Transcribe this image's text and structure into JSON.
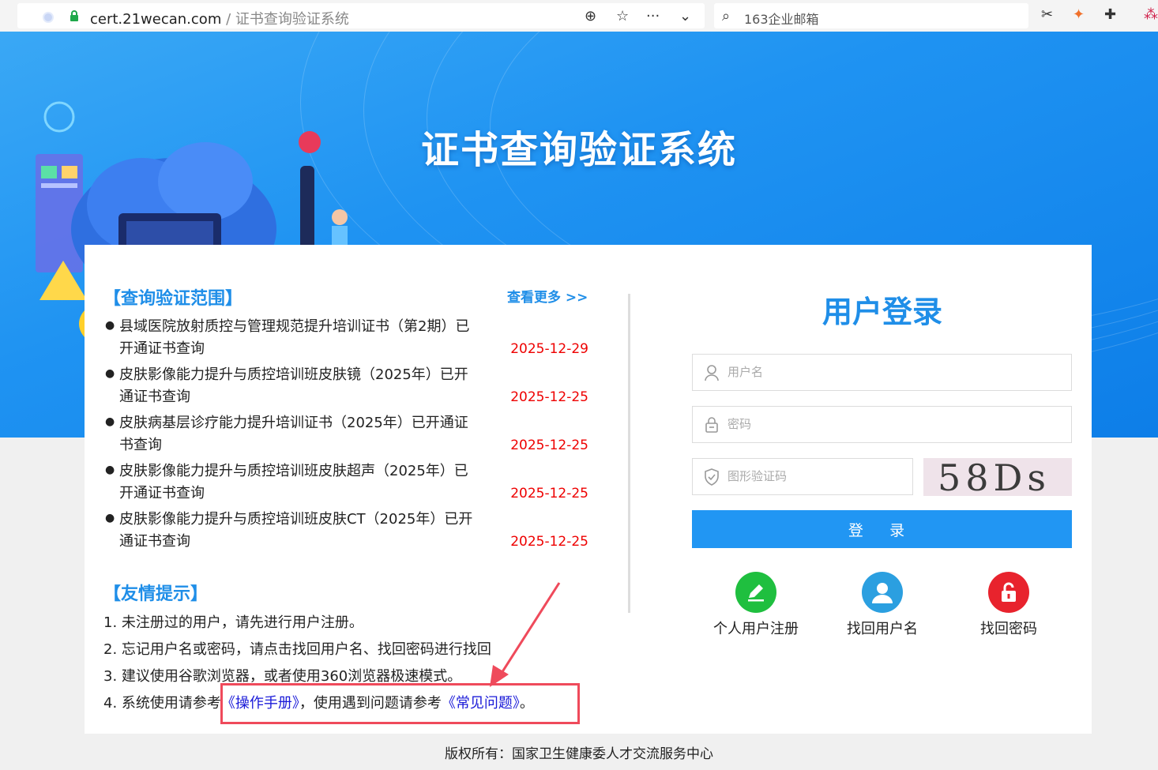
{
  "browser": {
    "url_domain": "cert.21wecan.com",
    "url_separator": " / ",
    "url_path": "证书查询验证系统",
    "search_placeholder": "163企业邮箱"
  },
  "banner": {
    "title": "证书查询验证系统"
  },
  "scope": {
    "title": "【查询验证范围】",
    "more_link": "查看更多 >>",
    "items": [
      {
        "text": "县域医院放射质控与管理规范提升培训证书（第2期）已开通证书查询",
        "date": "2025-12-29"
      },
      {
        "text": "皮肤影像能力提升与质控培训班皮肤镜（2025年）已开通证书查询",
        "date": "2025-12-25"
      },
      {
        "text": "皮肤病基层诊疗能力提升培训证书（2025年）已开通证书查询",
        "date": "2025-12-25"
      },
      {
        "text": "皮肤影像能力提升与质控培训班皮肤超声（2025年）已开通证书查询",
        "date": "2025-12-25"
      },
      {
        "text": "皮肤影像能力提升与质控培训班皮肤CT（2025年）已开通证书查询",
        "date": "2025-12-25"
      }
    ]
  },
  "tips": {
    "title": "【友情提示】",
    "items": [
      "1. 未注册过的用户，请先进行用户注册。",
      "2. 忘记用户名或密码，请点击找回用户名、找回密码进行找回",
      "3. 建议使用谷歌浏览器，或者使用360浏览器极速模式。"
    ],
    "tip4_prefix": "4. 系统使用请参考",
    "manual_link": "《操作手册》",
    "tip4_middle": "，使用遇到问题请参考",
    "faq_link": "《常见问题》",
    "tip4_suffix": "。"
  },
  "login": {
    "title": "用户登录",
    "username_placeholder": "用户名",
    "password_placeholder": "密码",
    "captcha_placeholder": "图形验证码",
    "captcha_text": "58Ds",
    "login_button": "登 录",
    "register_label": "个人用户注册",
    "find_username_label": "找回用户名",
    "find_password_label": "找回密码"
  },
  "colors": {
    "accent": "#1f8ee8",
    "date_red": "#e00000",
    "register_green": "#1fbf3f",
    "user_blue": "#2b9fe0",
    "password_red": "#e8232d",
    "annotation_red": "#ef4a5b"
  },
  "footer": {
    "copyright": "版权所有：国家卫生健康委人才交流服务中心"
  }
}
